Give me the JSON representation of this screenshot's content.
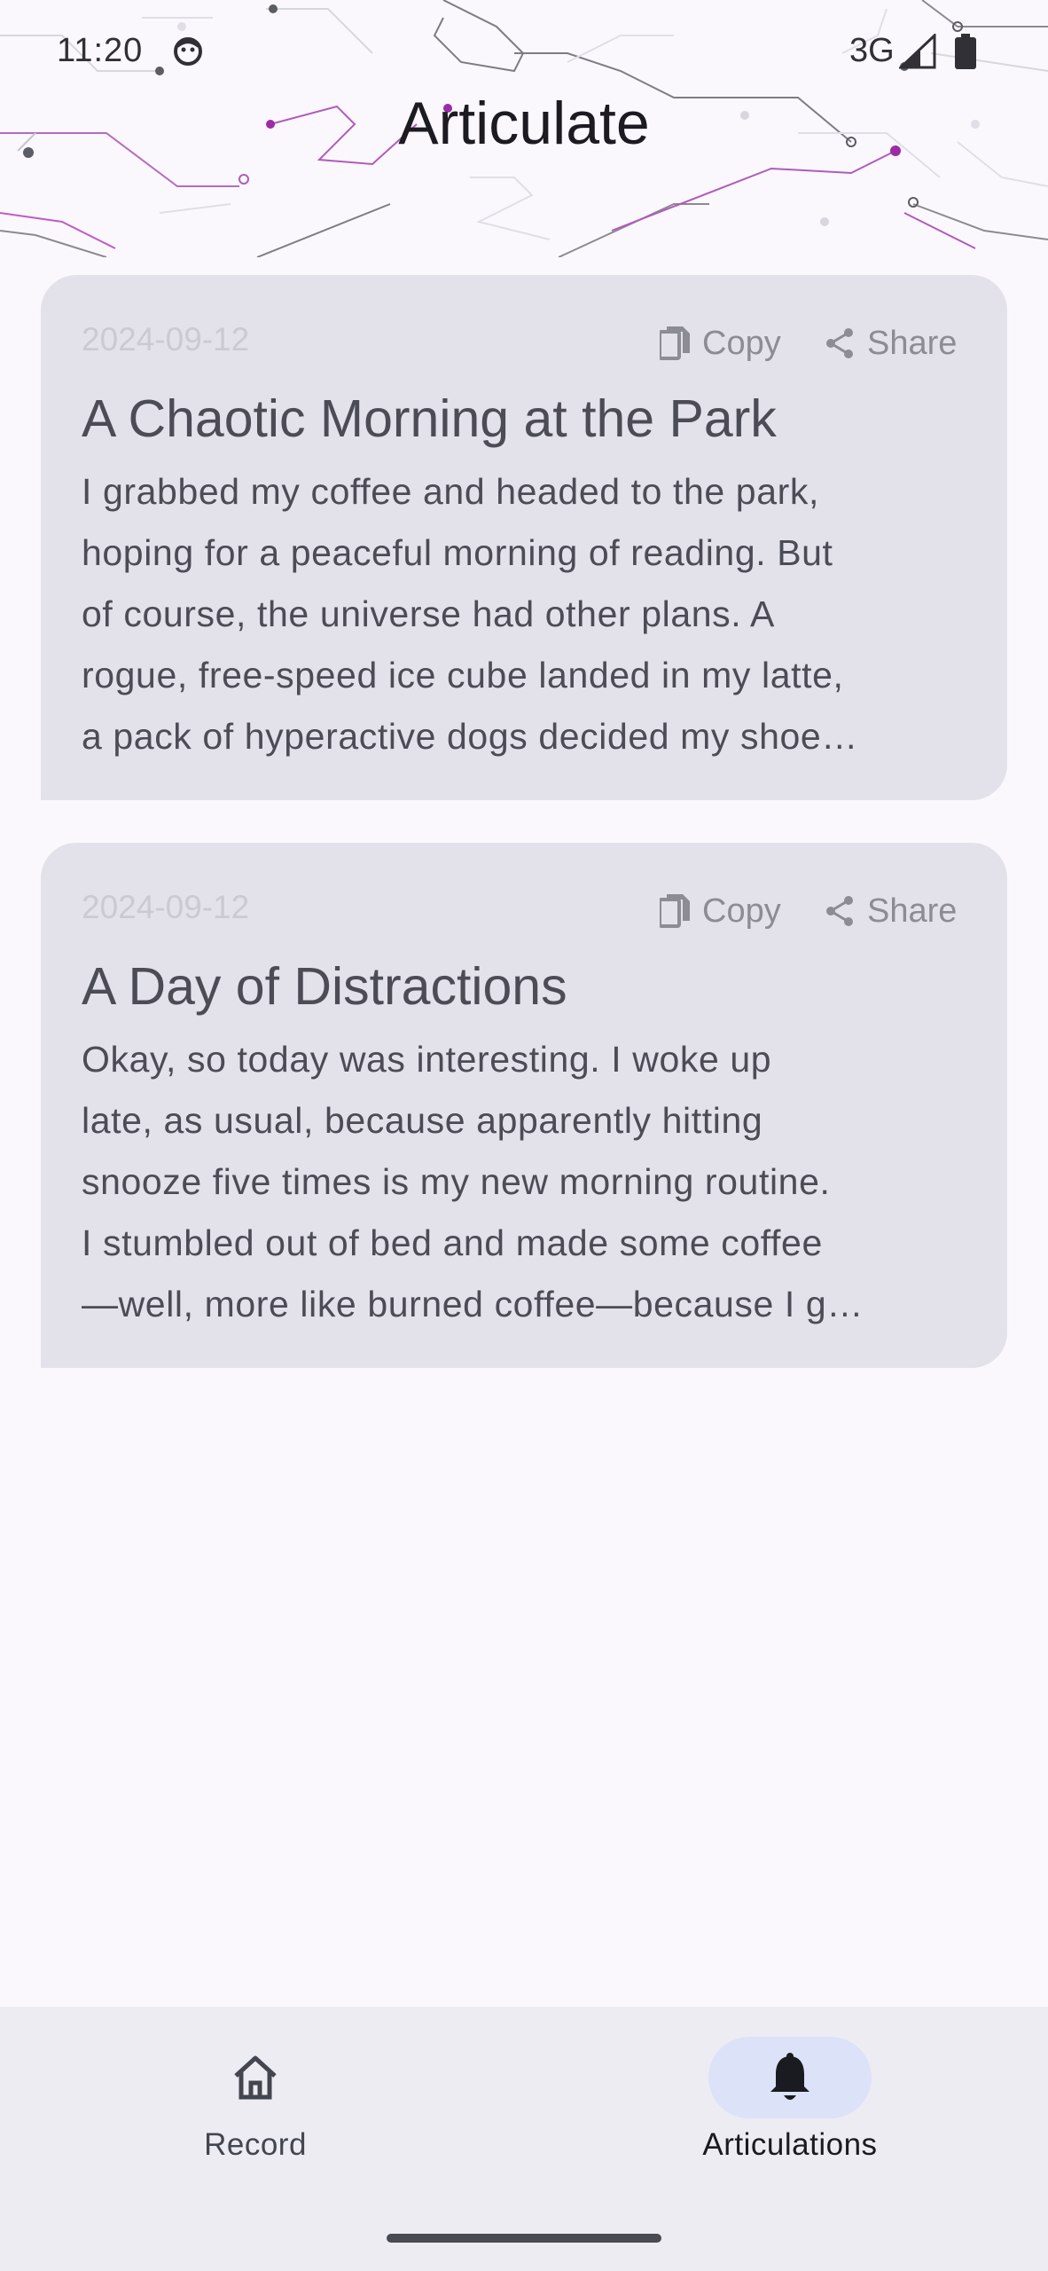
{
  "status_bar": {
    "time": "11:20",
    "network": "3G",
    "icons": [
      "face-icon",
      "signal-icon",
      "battery-icon"
    ]
  },
  "app": {
    "title": "Articulate"
  },
  "cards": [
    {
      "date": "2024-09-12",
      "copy_label": "Copy",
      "share_label": "Share",
      "title": "A Chaotic Morning at the Park",
      "body_lines": [
        "I grabbed my coffee and headed to the park,",
        "hoping for a peaceful morning of reading. But",
        "of course, the universe had other plans. A",
        "rogue, free-speed ice cube landed in my latte,",
        "a pack of hyperactive dogs decided my shoe…"
      ]
    },
    {
      "date": "2024-09-12",
      "copy_label": "Copy",
      "share_label": "Share",
      "title": "A Day of Distractions",
      "body_lines": [
        "Okay, so today was interesting. I woke up",
        "late, as usual, because apparently hitting",
        "snooze five times is my new morning routine.",
        "I stumbled out of bed and made some coffee",
        "—well, more like burned coffee—because I g…"
      ]
    }
  ],
  "bottom_nav": {
    "items": [
      {
        "label": "Record",
        "icon": "home-icon",
        "selected": false
      },
      {
        "label": "Articulations",
        "icon": "bell-icon",
        "selected": true
      }
    ]
  },
  "colors": {
    "background": "#FBF8FD",
    "card": "#E3E2EA",
    "nav_background": "#EDECF3",
    "nav_selected_pill": "#DCE2F8",
    "accent_purple": "#9C2BA6"
  }
}
